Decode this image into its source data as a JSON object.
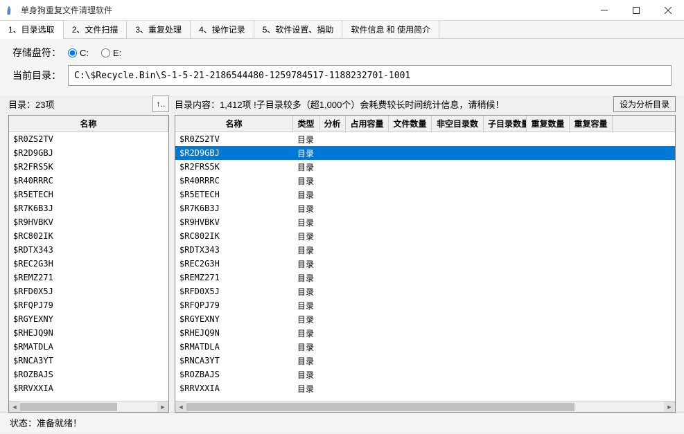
{
  "window": {
    "title": "单身狗重复文件清理软件"
  },
  "menu": {
    "items": [
      "1、目录选取",
      "2、文件扫描",
      "3、重复处理",
      "4、操作记录",
      "5、软件设置、捐助",
      "软件信息 和 使用简介"
    ]
  },
  "drive": {
    "label": "存储盘符：",
    "options": [
      "C:",
      "E:"
    ],
    "selected": 0
  },
  "path": {
    "label": "当前目录：",
    "value": "C:\\$Recycle.Bin\\S-1-5-21-2186544480-1259784517-1188232701-1001"
  },
  "left": {
    "info_prefix": "目录：",
    "count": "23项",
    "up_symbol": "↑..",
    "header": {
      "name": "名称"
    },
    "rows": [
      {
        "name": "$R0ZS2TV"
      },
      {
        "name": "$R2D9GBJ"
      },
      {
        "name": "$R2FRS5K"
      },
      {
        "name": "$R40RRRC"
      },
      {
        "name": "$R5ETECH"
      },
      {
        "name": "$R7K6B3J"
      },
      {
        "name": "$R9HVBKV"
      },
      {
        "name": "$RC802IK"
      },
      {
        "name": "$RDTX343"
      },
      {
        "name": "$REC2G3H"
      },
      {
        "name": "$REMZ271"
      },
      {
        "name": "$RFD0X5J"
      },
      {
        "name": "$RFQPJ79"
      },
      {
        "name": "$RGYEXNY"
      },
      {
        "name": "$RHEJQ9N"
      },
      {
        "name": "$RMATDLA"
      },
      {
        "name": "$RNCA3YT"
      },
      {
        "name": "$ROZBAJS"
      },
      {
        "name": "$RRVXXIA"
      }
    ]
  },
  "right": {
    "info_prefix": "目录内容：",
    "count": "1,412项",
    "warning": "  !子目录较多（超1,000个）会耗费较长时间统计信息，请稍候！",
    "analyze_btn": "设为分析目录",
    "header": {
      "name": "名称",
      "type": "类型",
      "analysis": "分析",
      "size": "占用容量",
      "files": "文件数量",
      "nonempty": "非空目录数",
      "subdirs": "子目录数量",
      "dupcount": "重复数量",
      "dupsize": "重复容量"
    },
    "selected_index": 1,
    "rows": [
      {
        "name": "$R0ZS2TV",
        "type": "目录"
      },
      {
        "name": "$R2D9GBJ",
        "type": "目录"
      },
      {
        "name": "$R2FRS5K",
        "type": "目录"
      },
      {
        "name": "$R40RRRC",
        "type": "目录"
      },
      {
        "name": "$R5ETECH",
        "type": "目录"
      },
      {
        "name": "$R7K6B3J",
        "type": "目录"
      },
      {
        "name": "$R9HVBKV",
        "type": "目录"
      },
      {
        "name": "$RC802IK",
        "type": "目录"
      },
      {
        "name": "$RDTX343",
        "type": "目录"
      },
      {
        "name": "$REC2G3H",
        "type": "目录"
      },
      {
        "name": "$REMZ271",
        "type": "目录"
      },
      {
        "name": "$RFD0X5J",
        "type": "目录"
      },
      {
        "name": "$RFQPJ79",
        "type": "目录"
      },
      {
        "name": "$RGYEXNY",
        "type": "目录"
      },
      {
        "name": "$RHEJQ9N",
        "type": "目录"
      },
      {
        "name": "$RMATDLA",
        "type": "目录"
      },
      {
        "name": "$RNCA3YT",
        "type": "目录"
      },
      {
        "name": "$ROZBAJS",
        "type": "目录"
      },
      {
        "name": "$RRVXXIA",
        "type": "目录"
      }
    ]
  },
  "status": {
    "label": "状态：",
    "text": "准备就绪！"
  }
}
